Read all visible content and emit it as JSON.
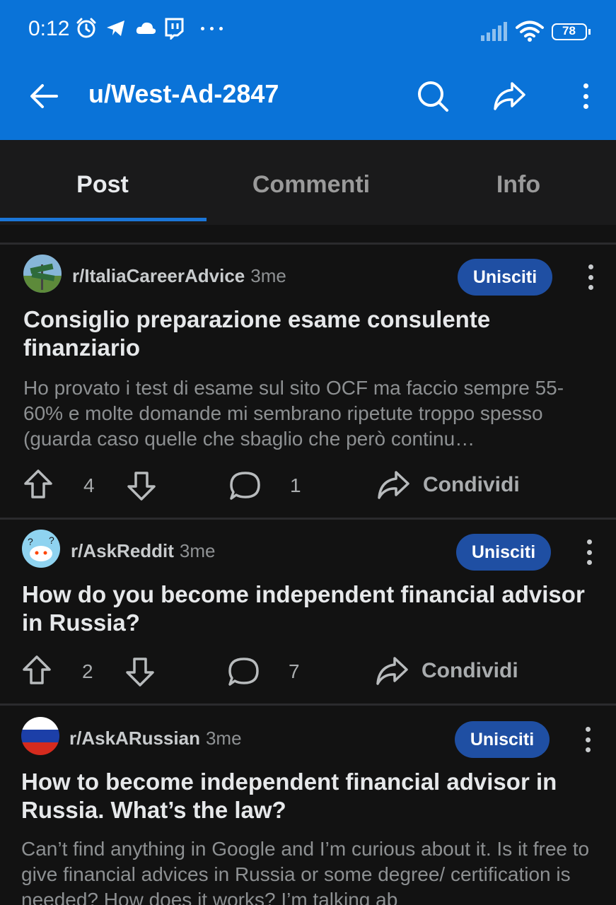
{
  "status_bar": {
    "time": "0:12",
    "battery": "78"
  },
  "toolbar": {
    "title": "u/West-Ad-2847"
  },
  "tabs": [
    {
      "label": "Post"
    },
    {
      "label": "Commenti"
    },
    {
      "label": "Info"
    }
  ],
  "posts": [
    {
      "subreddit": "r/ItaliaCareerAdvice",
      "age": "3me",
      "join_label": "Unisciti",
      "title": "Consiglio preparazione esame consulente finanziario",
      "body": "Ho provato i test di esame sul sito OCF ma faccio sempre 55-60% e molte domande mi sembrano ripetute troppo spesso (guarda caso quelle che sbaglio che però continu…",
      "votes": "4",
      "comments": "1",
      "share_label": "Condividi"
    },
    {
      "subreddit": "r/AskReddit",
      "age": "3me",
      "join_label": "Unisciti",
      "title": "How do you become independent financial advisor in Russia?",
      "votes": "2",
      "comments": "7",
      "share_label": "Condividi"
    },
    {
      "subreddit": "r/AskARussian",
      "age": "3me",
      "join_label": "Unisciti",
      "title": "How to become independent financial advisor in Russia. What’s the law?",
      "body": "Can’t find anything in Google and I’m curious about it. Is it free to give financial advices in Russia or some degree/ certification is needed? How does it works? I’m talking ab"
    }
  ]
}
